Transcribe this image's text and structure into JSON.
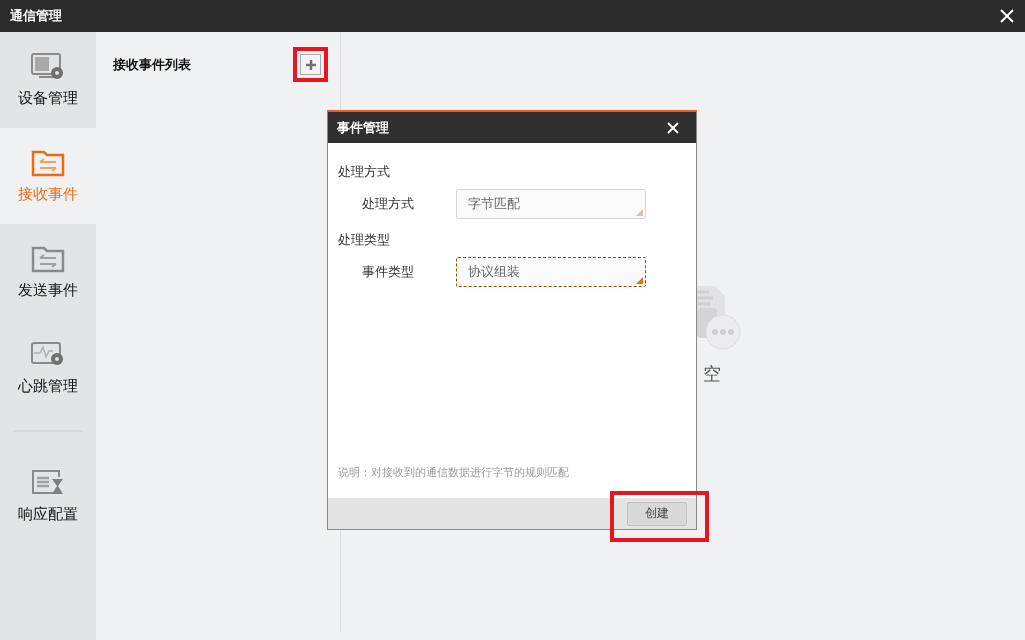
{
  "window": {
    "title": "通信管理"
  },
  "sidebar": {
    "items": [
      {
        "label": "设备管理",
        "selected": false
      },
      {
        "label": "接收事件",
        "selected": true
      },
      {
        "label": "发送事件",
        "selected": false
      },
      {
        "label": "心跳管理",
        "selected": false
      }
    ],
    "bottom_items": [
      {
        "label": "响应配置",
        "selected": false
      }
    ]
  },
  "list_panel": {
    "title": "接收事件列表",
    "add_button": {
      "highlighted": true
    }
  },
  "empty_state": {
    "text": "空"
  },
  "dialog": {
    "title": "事件管理",
    "sections": [
      {
        "heading": "处理方式",
        "label": "处理方式",
        "value": "字节匹配",
        "focused": false
      },
      {
        "heading": "处理类型",
        "label": "事件类型",
        "value": "协议组装",
        "focused": true
      }
    ],
    "note": "说明：对接收到的通信数据进行字节的规则匹配",
    "create_button": {
      "label": "创建",
      "highlighted": true
    }
  }
}
